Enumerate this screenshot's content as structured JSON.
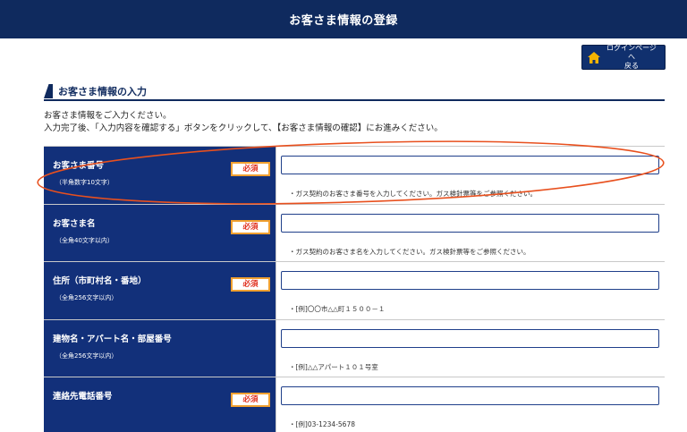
{
  "header": {
    "title": "お客さま情報の登録"
  },
  "login_button": {
    "label_line1": "ログインページへ",
    "label_line2": "戻る",
    "icon": "home-icon"
  },
  "section": {
    "heading": "お客さま情報の入力"
  },
  "intro": {
    "line1": "お客さま情報をご入力ください。",
    "line2": "入力完了後、「入力内容を確認する」ボタンをクリックして、【お客さま情報の確認】にお進みください。"
  },
  "form": {
    "required_label": "必須",
    "rows": [
      {
        "label": "お客さま番号",
        "sub": "（半角数字10文字）",
        "required": true,
        "value": "",
        "hint": "・ガス契約のお客さま番号を入力してください。ガス検針票等をご参照ください。"
      },
      {
        "label": "お客さま名",
        "sub": "（全角40文字以内）",
        "required": true,
        "value": "",
        "hint": "・ガス契約のお客さま名を入力してください。ガス検針票等をご参照ください。"
      },
      {
        "label": "住所（市町村名・番地）",
        "sub": "（全角256文字以内）",
        "required": true,
        "value": "",
        "hint": "・[例]〇〇市△△町１５００－１"
      },
      {
        "label": "建物名・アパート名・部屋番号",
        "sub": "（全角256文字以内）",
        "required": false,
        "value": "",
        "hint": "・[例]△△アパート１０１号室"
      },
      {
        "label": "連絡先電話番号",
        "sub": "",
        "required": true,
        "value": "",
        "hint": "・[例]03-1234-5678"
      }
    ]
  },
  "colors": {
    "navy": "#0f2a5e",
    "label_bg": "#12307a",
    "badge_border": "#f0a030",
    "badge_text": "#e0301e",
    "annotation": "#e8501e"
  }
}
